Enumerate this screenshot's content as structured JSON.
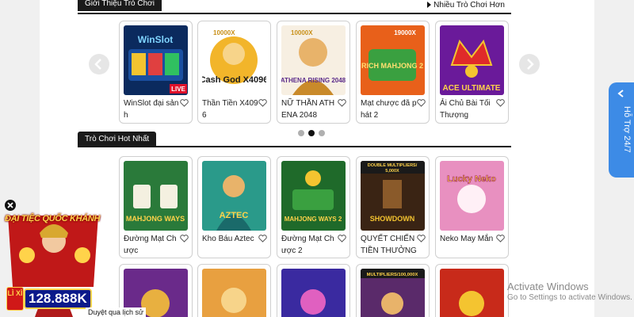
{
  "sections": {
    "intro": {
      "title": "Giới Thiệu Trò Chơi",
      "more_label": "Nhiều Trò Chơi Hơn"
    },
    "hot": {
      "title": "Trò Chơi Hot Nhất"
    }
  },
  "intro_cards": [
    {
      "title": "WinSlot đại sảnh",
      "art_text": "WinSlot",
      "badge": "LIVE"
    },
    {
      "title": "Thần Tiền X4096",
      "art_text": "Cash God X4096",
      "badge": "10000X"
    },
    {
      "title": "NỮ THẦN ATHENA 2048",
      "art_text": "ATHENA RISING 2048",
      "badge": "10000X"
    },
    {
      "title": "Mạt chược đã phát 2",
      "art_text": "RICH MAHJONG 2",
      "badge": "19000X"
    },
    {
      "title": "Ải Chủ Bài Tối Thượng",
      "art_text": "ACE ULTIMATE",
      "badge": ""
    }
  ],
  "carousel": {
    "dot_count": 3,
    "active_dot": 1
  },
  "hot_cards": [
    {
      "title": "Đường Mạt Chược",
      "art_text": "MAHJONG WAYS"
    },
    {
      "title": "Kho Báu Aztec",
      "art_text": "AZTEC"
    },
    {
      "title": "Đường Mạt Chược 2",
      "art_text": "MAHJONG WAYS 2"
    },
    {
      "title": "QUYẾT CHIẾN TIỀN THƯỞNG",
      "art_text": "SHOWDOWN",
      "badge": "DOUBLE MULTIPLIERS/ 5,000X"
    },
    {
      "title": "Neko May Mắn",
      "art_text": "Lucky Neko"
    }
  ],
  "third_row_badges": [
    "MULTIPLIERS/100,000X"
  ],
  "support": {
    "label": "Hỗ Trợ 24/7",
    "color": "#3d8be6"
  },
  "promo": {
    "title": "ĐẠI TIỆC QUỐC KHÁNH",
    "amount": "128.888K",
    "lixi": "LÌ XÌ"
  },
  "watermark": {
    "line1": "Activate Windows",
    "line2": "Go to Settings to activate Windows."
  },
  "bottom_link": "Duyệt qua lịch sử"
}
